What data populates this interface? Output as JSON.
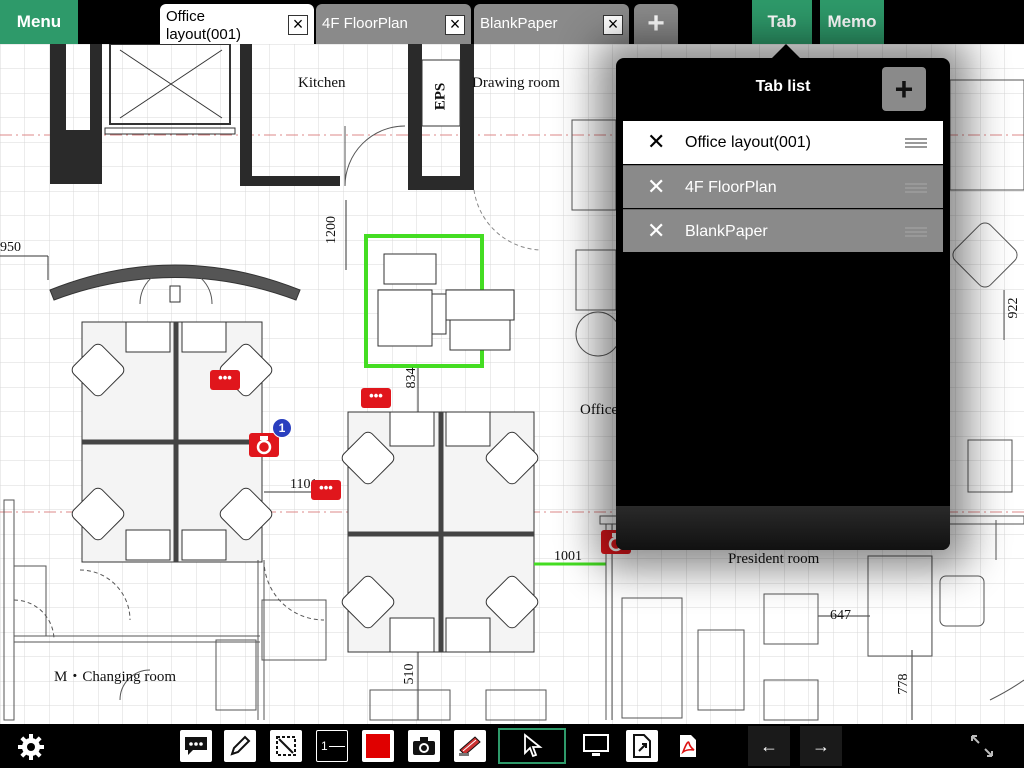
{
  "topbar": {
    "menu_label": "Menu",
    "tab_label": "Tab",
    "memo_label": "Memo",
    "close_glyph": "×",
    "add_glyph": "+",
    "tabs": [
      {
        "label": "Office layout(001)",
        "active": true
      },
      {
        "label": "4F FloorPlan",
        "active": false
      },
      {
        "label": "BlankPaper",
        "active": false
      }
    ]
  },
  "floorplan": {
    "rooms": {
      "kitchen": "Kitchen",
      "eps": "EPS",
      "drawing_room": "Drawing room",
      "office": "Office",
      "president_room": "President room",
      "changing_room": "M・Changing room"
    },
    "dimensions": {
      "d950": "950",
      "d1200": "1200",
      "d834": "834",
      "d1101": "1101",
      "d1001": "1001",
      "d647": "647",
      "d510": "510",
      "d778": "778",
      "d922": "922"
    },
    "camera_badge_count": "1",
    "comment_glyph": "•••"
  },
  "tab_list": {
    "title": "Tab list",
    "add_glyph": "+",
    "close_glyph": "✕",
    "items": [
      {
        "label": "Office layout(001)",
        "selected": true
      },
      {
        "label": "4F FloorPlan",
        "selected": false
      },
      {
        "label": "BlankPaper",
        "selected": false
      }
    ]
  },
  "toolbar": {
    "stroke_width_label": "1",
    "prev_arrow": "←",
    "next_arrow": "→",
    "pen_color": "#e00000",
    "accent_color": "#2e9a6a",
    "tools": [
      "comment-tool",
      "pen-tool",
      "selection-rect-tool",
      "stroke-width-tool",
      "color-tool",
      "camera-tool",
      "stamp-tool",
      "pointer-tool",
      "display-tool",
      "export-tool",
      "pdf-tool"
    ]
  },
  "colors": {
    "accent_green": "#2e9a6a",
    "tab_gray": "#8a8a8a",
    "marker_red": "#e00000",
    "badge_blue": "#2a3fbf",
    "selection_green": "#44dd22"
  }
}
